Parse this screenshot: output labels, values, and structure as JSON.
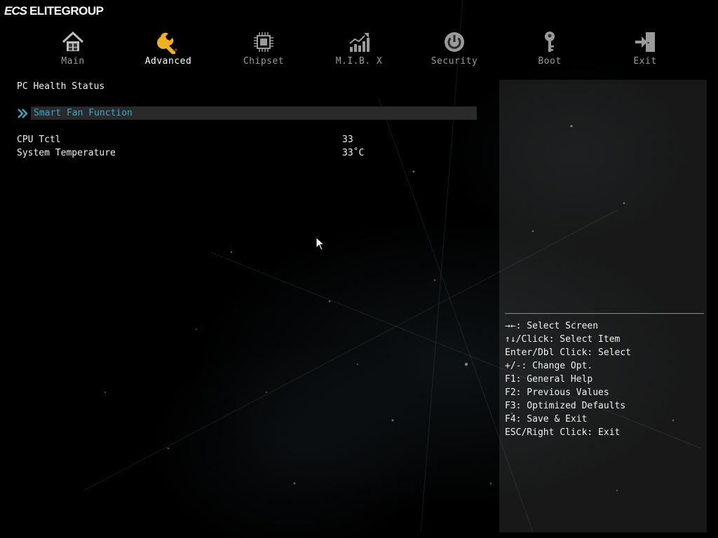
{
  "brand": {
    "mark": "ECS",
    "name": "ELITEGROUP"
  },
  "nav": {
    "tabs": [
      {
        "id": "main",
        "label": "Main",
        "icon": "home-icon"
      },
      {
        "id": "advanced",
        "label": "Advanced",
        "icon": "wrench-icon",
        "active": true
      },
      {
        "id": "chipset",
        "label": "Chipset",
        "icon": "chip-icon"
      },
      {
        "id": "mibx",
        "label": "M.I.B. X",
        "icon": "performance-chart-icon"
      },
      {
        "id": "security",
        "label": "Security",
        "icon": "power-icon"
      },
      {
        "id": "boot",
        "label": "Boot",
        "icon": "key-icon"
      },
      {
        "id": "exit",
        "label": "Exit",
        "icon": "exit-door-icon"
      }
    ]
  },
  "main": {
    "section_title": "PC Health Status",
    "submenu_label": "Smart Fan Function",
    "readings": [
      {
        "label": "CPU Tctl",
        "value": "33"
      },
      {
        "label": "System Temperature",
        "value": "33˚C"
      }
    ]
  },
  "help": {
    "items": [
      "→←: Select Screen",
      "↑↓/Click: Select Item",
      "Enter/Dbl Click: Select",
      "+/-: Change Opt.",
      "F1: General Help",
      "F2: Previous Values",
      "F3: Optimized Defaults",
      "F4: Save & Exit",
      "ESC/Right Click: Exit"
    ]
  },
  "colors": {
    "background": "#000000",
    "accent_highlight": "#3aa6c9",
    "active_icon": "#f0b020",
    "inactive_label": "#9a9a9a",
    "selection_bar": "#2a2a2a"
  }
}
